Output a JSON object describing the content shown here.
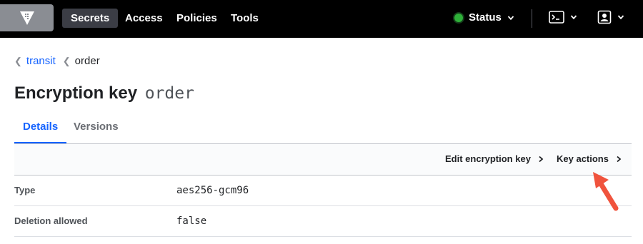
{
  "nav": {
    "items": [
      {
        "label": "Secrets",
        "active": true
      },
      {
        "label": "Access",
        "active": false
      },
      {
        "label": "Policies",
        "active": false
      },
      {
        "label": "Tools",
        "active": false
      }
    ],
    "status_label": "Status",
    "status_color": "#2eb039"
  },
  "breadcrumb": {
    "link": "transit",
    "current": "order"
  },
  "title": {
    "prefix": "Encryption key",
    "name": "order"
  },
  "tabs": [
    {
      "label": "Details",
      "active": true
    },
    {
      "label": "Versions",
      "active": false
    }
  ],
  "toolbar": {
    "edit_label": "Edit encryption key",
    "key_actions_label": "Key actions"
  },
  "details": [
    {
      "label": "Type",
      "value": "aes256-gcm96"
    },
    {
      "label": "Deletion allowed",
      "value": "false"
    }
  ],
  "colors": {
    "accent": "#1563ff",
    "annotation": "#f0533d"
  }
}
